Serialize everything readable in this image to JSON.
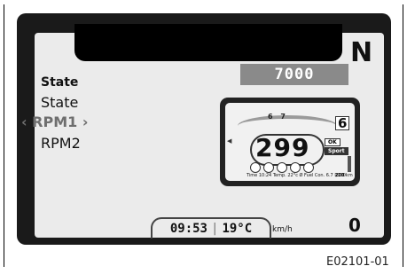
{
  "display": {
    "gear_indicator_top": "N",
    "menu": {
      "items": [
        {
          "label": "State",
          "state": "selected"
        },
        {
          "label": "State",
          "state": "normal"
        },
        {
          "label": "‹ RPM1 ›",
          "state": "focused"
        },
        {
          "label": "RPM2",
          "state": "normal"
        }
      ]
    },
    "value_box": "7000",
    "mini_dashboard": {
      "rpm_labels": "6 7",
      "gear": "6",
      "speed": "299",
      "status_ok": "OK",
      "riding_mode": "Sport",
      "info_strip": "Time 10:24   Temp. 22°c   Ø Fuel Con. 6.7 l/100km",
      "info_right": "200"
    },
    "bottom": {
      "time": "09:53",
      "separator": "|",
      "temperature": "19°C",
      "speed_unit": "km/h",
      "gear_bottom": "0"
    }
  },
  "figure_code": "E02101-01",
  "colors": {
    "panel": "#1a1a1a",
    "screen": "#ebebeb",
    "value_box": "#8a8a8a"
  }
}
